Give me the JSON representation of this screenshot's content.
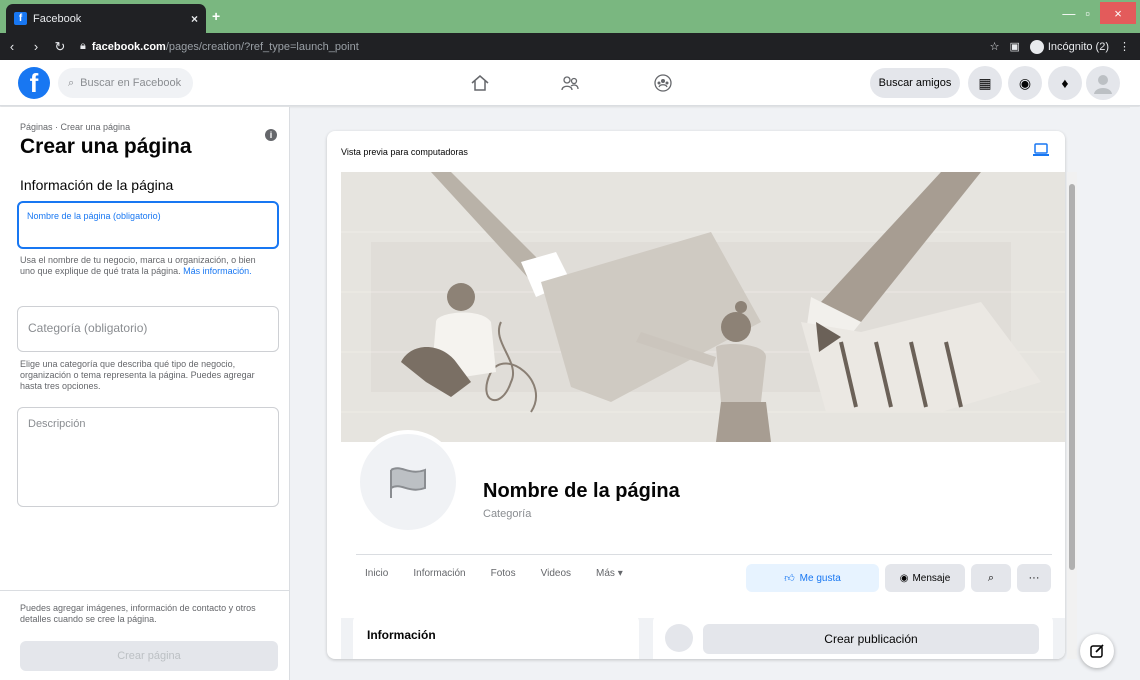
{
  "browser": {
    "tab_title": "Facebook",
    "tab_close": "×",
    "new_tab": "+",
    "url_host": "facebook.com",
    "url_path": "/pages/creation/?ref_type=launch_point",
    "profile_label": "Incógnito (2)",
    "win_min": "—",
    "win_max": "▫",
    "win_close": "×"
  },
  "fb": {
    "search_placeholder": "Buscar en Facebook",
    "find_friends": "Buscar amigos",
    "colors": {
      "brand": "#1877f2",
      "bg": "#f0f2f5",
      "text": "#050505",
      "muted": "#65676b"
    }
  },
  "left": {
    "breadcrumb": "Páginas · Crear una página",
    "title": "Crear una página",
    "section_title": "Información de la página",
    "name_placeholder": "Nombre de la página (obligatorio)",
    "name_help": "Usa el nombre de tu negocio, marca u organización, o bien uno que explique de qué trata la página.",
    "name_help_link": "Más información.",
    "category_placeholder": "Categoría (obligatorio)",
    "category_help": "Elige una categoría que describa qué tipo de negocio, organización o tema representa la página. Puedes agregar hasta tres opciones.",
    "description_placeholder": "Descripción",
    "footer_note": "Puedes agregar imágenes, información de contacto y otros detalles cuando se cree la página.",
    "create_button": "Crear página"
  },
  "preview": {
    "title": "Vista previa para computadoras",
    "page_name": "Nombre de la página",
    "category": "Categoría",
    "tabs": [
      "Inicio",
      "Información",
      "Fotos",
      "Videos",
      "Más ▾"
    ],
    "like_button": "Me gusta",
    "message_button": "Mensaje",
    "more_button": "···",
    "info_title": "Información",
    "create_post": "Crear publicación"
  }
}
